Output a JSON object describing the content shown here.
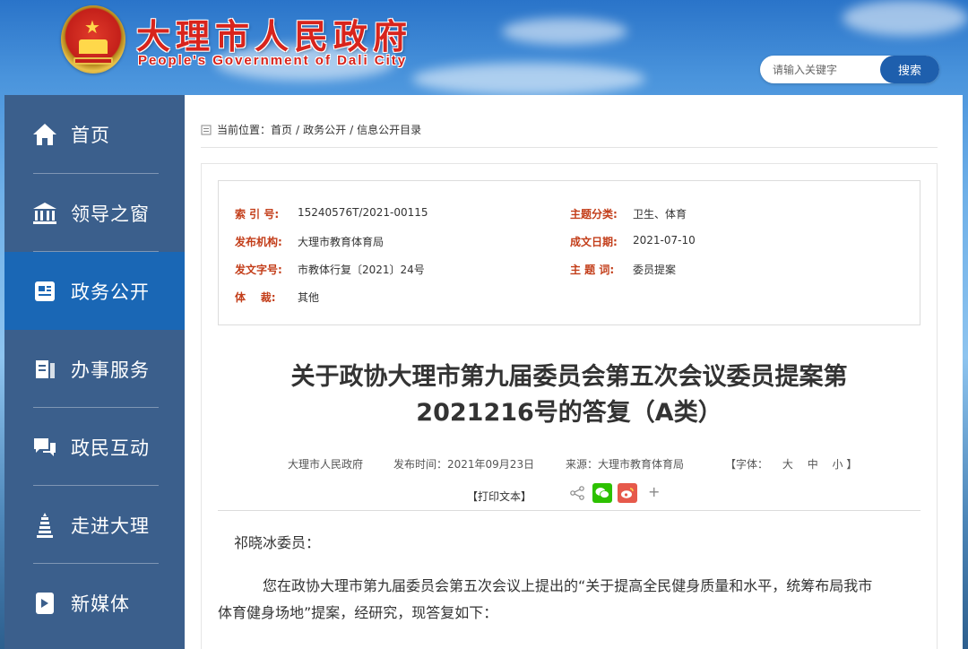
{
  "header": {
    "title": "大理市人民政府",
    "subtitle": "People's Government of Dali City",
    "search": {
      "placeholder": "请输入关键字",
      "button": "搜索"
    }
  },
  "sidebar": {
    "items": [
      {
        "label": "首页",
        "icon": "home-icon"
      },
      {
        "label": "领导之窗",
        "icon": "bank-icon"
      },
      {
        "label": "政务公开",
        "icon": "document-icon",
        "active": true
      },
      {
        "label": "办事服务",
        "icon": "service-icon"
      },
      {
        "label": "政民互动",
        "icon": "chat-icon"
      },
      {
        "label": "走进大理",
        "icon": "pagoda-icon"
      },
      {
        "label": "新媒体",
        "icon": "media-icon"
      }
    ]
  },
  "breadcrumb": {
    "prefix": "当前位置：",
    "items": [
      "首页",
      "政务公开",
      "信息公开目录"
    ],
    "separator": "/"
  },
  "meta": {
    "index_key": "索 引 号:",
    "index_value": "15240576T/2021-00115",
    "topic_key": "主题分类:",
    "topic_value": "卫生、体育",
    "org_key": "发布机构:",
    "org_value": "大理市教育体育局",
    "date_key": "成文日期:",
    "date_value": "2021-07-10",
    "docno_key": "发文字号:",
    "docno_value": "市教体行复〔2021〕24号",
    "subject_key": "主 题 词:",
    "subject_value": "委员提案",
    "genre_key": "体    裁:",
    "genre_value": "其他"
  },
  "article": {
    "title_line1": "关于政协大理市第九届委员会第五次会议委员提案第",
    "title_line2": "2021216号的答复（A类）",
    "publisher": "大理市人民政府",
    "publish_time": "发布时间：2021年09月23日",
    "source": "来源：大理市教育体育局",
    "font_label": "【字体：",
    "font_large": "大",
    "font_medium": "中",
    "font_small": "小 】",
    "print": "【打印文本】",
    "share_plus": "+",
    "greeting": "祁晓冰委员：",
    "body_line1": "您在政协大理市第九届委员会第五次会议上提出的“关于提高全民健身质量和水平，统筹布局我市",
    "body_line2": "体育健身场地”提案，经研究，现答复如下："
  },
  "colors": {
    "brand_red": "#d8241c",
    "nav_bg": "#3b5f8c",
    "nav_active": "#1a67b5",
    "meta_key": "#c33e1a",
    "search_btn": "#1e5fad",
    "wechat": "#2dc100",
    "weibo": "#e6594b"
  }
}
